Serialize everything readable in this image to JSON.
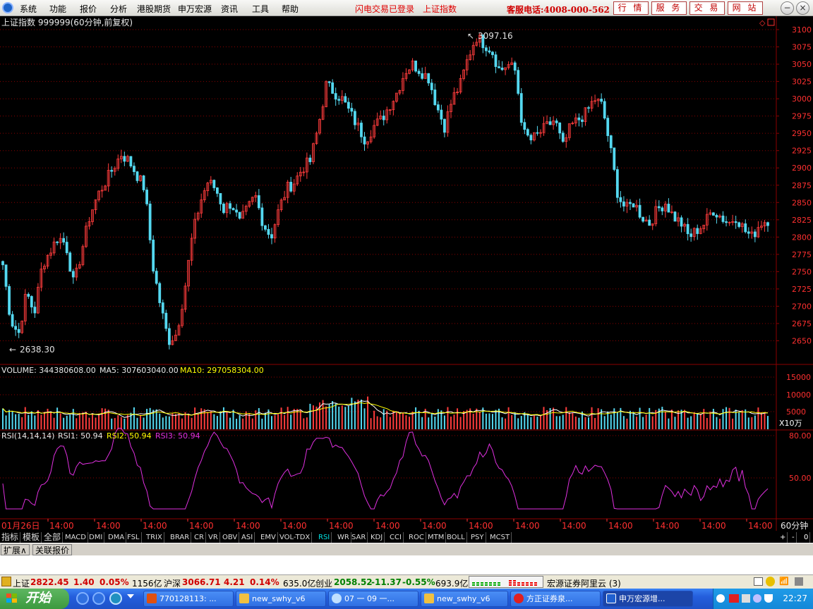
{
  "menu": {
    "items": [
      "系统",
      "功能",
      "报价",
      "分析",
      "港股期货",
      "申万宏源",
      "资讯",
      "工具",
      "帮助"
    ],
    "status1": "闪电交易已登录",
    "status2": "上证指数",
    "hotline": "客服电话:4008-000-562",
    "buttons": [
      "行 情",
      "服 务",
      "交 易",
      "网 站"
    ]
  },
  "chart": {
    "title": "上证指数 999999(60分钟,前复权)",
    "high_label": "3097.16",
    "low_label": "2638.30",
    "price_axis": [
      "3100",
      "3075",
      "3050",
      "3025",
      "3000",
      "2975",
      "2950",
      "2925",
      "2900",
      "2875",
      "2850",
      "2825",
      "2800",
      "2775",
      "2750",
      "2725",
      "2700",
      "2675",
      "2650"
    ],
    "volume_label": "VOLUME: 344380608.00",
    "ma5_label": "MA5: 307603040.00",
    "ma10_label": "MA10: 297058304.00",
    "volume_axis": [
      "15000",
      "10000",
      "5000"
    ],
    "volume_unit": "X10万",
    "rsi_label": "RSI(14,14,14)",
    "rsi1_label": "RSI1: 50.94",
    "rsi2_label": "RSI2: 50.94",
    "rsi3_label": "RSI3: 50.94",
    "rsi_axis": [
      "80.00",
      "50.00"
    ],
    "date_first": "01月26日",
    "time_label": "14:00",
    "period": "60分钟",
    "colors": {
      "up": "#ff3c3c",
      "down": "#54d8f0",
      "ma5": "#ffffff",
      "ma10": "#ffff00",
      "rsi": "#e030e0",
      "grid": "#8b0000"
    }
  },
  "chart_data": {
    "type": "candlestick",
    "title": "上证指数 999999(60分钟,前复权)",
    "ylim": [
      2638.3,
      3100
    ],
    "high": 3097.16,
    "low": 2638.3,
    "close_points": [
      2760,
      2680,
      2660,
      2720,
      2690,
      2760,
      2780,
      2800,
      2790,
      2730,
      2780,
      2830,
      2860,
      2880,
      2900,
      2920,
      2910,
      2890,
      2870,
      2760,
      2700,
      2650,
      2660,
      2720,
      2800,
      2850,
      2880,
      2870,
      2840,
      2850,
      2820,
      2840,
      2860,
      2820,
      2800,
      2840,
      2870,
      2880,
      2900,
      2910,
      2960,
      3020,
      3010,
      3000,
      2980,
      2960,
      2940,
      2960,
      2970,
      2990,
      3010,
      3040,
      3050,
      3040,
      3030,
      2990,
      2960,
      3000,
      3020,
      3060,
      3090,
      3080,
      3070,
      3040,
      3050,
      3040,
      2950,
      2940,
      2950,
      2960,
      2970,
      2930,
      2960,
      2970,
      2980,
      3000,
      2990,
      2930,
      2860,
      2840,
      2850,
      2830,
      2820,
      2840,
      2850,
      2830,
      2820,
      2800,
      2810,
      2820,
      2840,
      2830,
      2820,
      2830,
      2810,
      2800,
      2820,
      2825
    ],
    "volume_latest": 344380608.0,
    "ma5": 307603040.0,
    "ma10": 297058304.0,
    "rsi": 50.94
  },
  "tabs": [
    "指标",
    "模板",
    "全部",
    "MACD",
    "DMI",
    "DMA",
    "FSL",
    "TRIX",
    "BRAR",
    "CR",
    "VR",
    "OBV",
    "ASI",
    "EMV",
    "VOL-TDX",
    "RSI",
    "WR",
    "SAR",
    "KDJ",
    "CCI",
    "ROC",
    "MTM",
    "BOLL",
    "PSY",
    "MCST"
  ],
  "tabs_right": [
    "+",
    "-",
    "0"
  ],
  "expand": [
    "扩展∧",
    "关联报价"
  ],
  "ticker": {
    "sh_name": "上证",
    "sh_val": "2822.45",
    "sh_chg": "1.40",
    "sh_pct": "0.05%",
    "sh_amt": "1156亿",
    "hs_name": "沪深",
    "hs_val": "3066.71",
    "hs_chg": "4.21",
    "hs_pct": "0.14%",
    "hs_amt": "635.0亿",
    "cy_name": "创业",
    "cy_val": "2058.52",
    "cy_chg": "-11.37",
    "cy_pct": "-0.55%",
    "cy_amt": "693.9亿",
    "broker": "宏源证券阿里云 (3)"
  },
  "taskbar": {
    "start": "开始",
    "items": [
      "770128113: ...",
      "new_swhy_v6",
      "07 一 09 一...",
      "new_swhy_v6",
      "方正证券泉...",
      "申万宏源增..."
    ],
    "clock": "22:27"
  }
}
